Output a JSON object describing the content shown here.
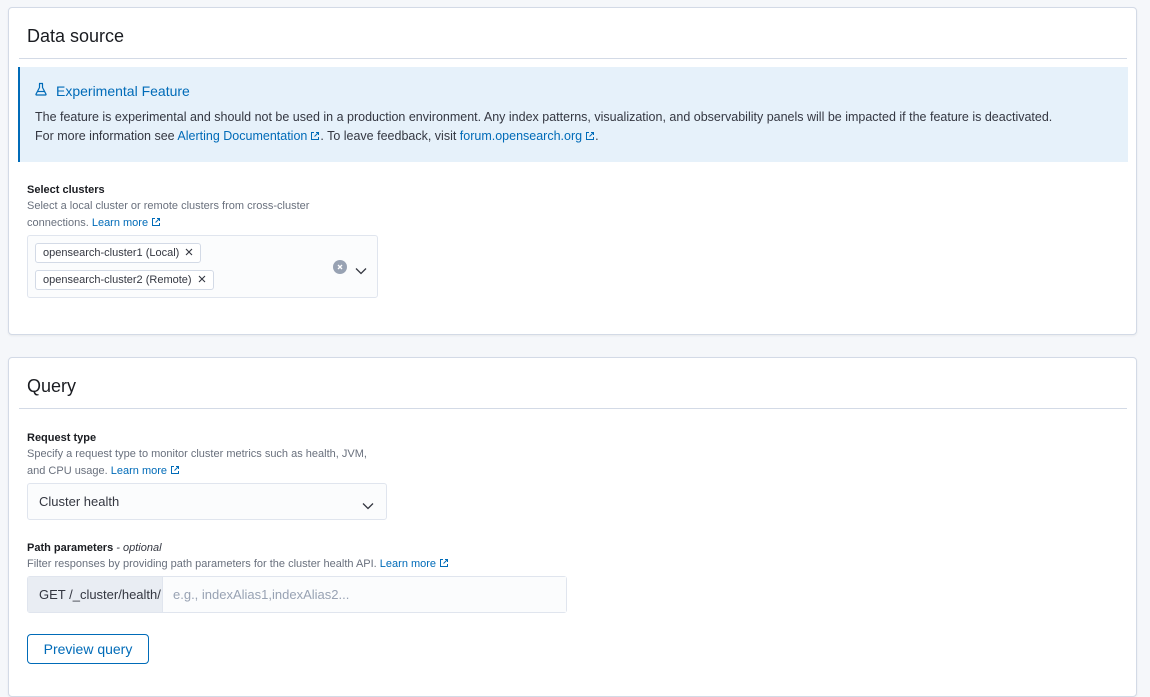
{
  "data_source": {
    "title": "Data source",
    "callout": {
      "title": "Experimental Feature",
      "text_1": "The feature is experimental and should not be used in a production environment. Any index patterns, visualization, and observability panels will be impacted if the feature is deactivated. For more information see ",
      "alerting_link": "Alerting Documentation",
      "text_2": ". To leave feedback, visit ",
      "forum_link": "forum.opensearch.org",
      "text_3": "."
    },
    "clusters": {
      "label": "Select clusters",
      "help_1": "Select a local cluster or remote clusters from cross-cluster",
      "help_2": "connections.",
      "learn_more": "Learn more",
      "selected": [
        "opensearch-cluster1 (Local)",
        "opensearch-cluster2 (Remote)"
      ]
    }
  },
  "query": {
    "title": "Query",
    "request_type": {
      "label": "Request type",
      "help_1": "Specify a request type to monitor cluster metrics such as health, JVM,",
      "help_2": "and CPU usage.",
      "learn_more": "Learn more",
      "value": "Cluster health"
    },
    "path_params": {
      "label": "Path parameters",
      "optional": " - optional",
      "help": "Filter responses by providing path parameters for the cluster health API.",
      "learn_more": "Learn more",
      "prefix": "GET /_cluster/health/",
      "placeholder": "e.g., indexAlias1,indexAlias2...",
      "value": ""
    },
    "preview_button": "Preview query"
  },
  "colors": {
    "accent": "#006bb8",
    "callout_bg": "#e6f1fa",
    "border": "#d3dae6"
  }
}
